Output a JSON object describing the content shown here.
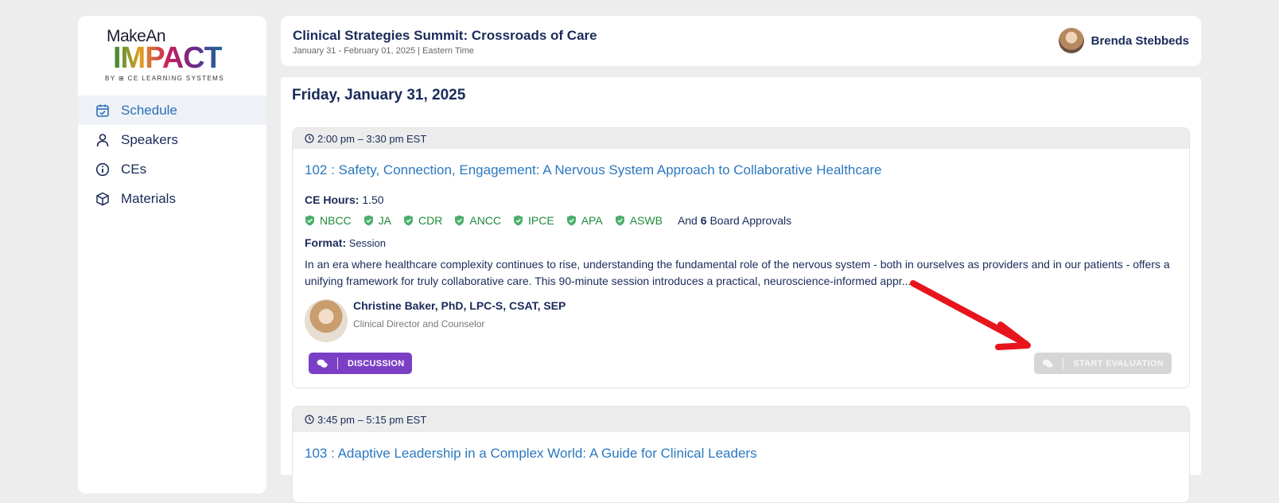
{
  "sidebar": {
    "logo": {
      "line1": "MakeAn",
      "line2": "IMPACT",
      "line3": "BY ⊞ CE LEARNING SYSTEMS"
    },
    "items": [
      {
        "label": "Schedule",
        "icon": "calendar-check-icon",
        "active": true
      },
      {
        "label": "Speakers",
        "icon": "user-icon",
        "active": false
      },
      {
        "label": "CEs",
        "icon": "info-circle-icon",
        "active": false
      },
      {
        "label": "Materials",
        "icon": "box-icon",
        "active": false
      }
    ]
  },
  "header": {
    "title": "Clinical Strategies Summit: Crossroads of Care",
    "dates": "January 31 - February 01, 2025 | Eastern Time",
    "user_name": "Brenda Stebbeds"
  },
  "main": {
    "day_heading": "Friday, January 31, 2025",
    "sessions": [
      {
        "time": "2:00 pm – 3:30 pm EST",
        "title": "102 : Safety, Connection, Engagement: A Nervous System Approach to Collaborative Healthcare",
        "ce_hours_label": "CE Hours:",
        "ce_hours_value": "1.50",
        "approvals": [
          "NBCC",
          "JA",
          "CDR",
          "ANCC",
          "IPCE",
          "APA",
          "ASWB"
        ],
        "more_prefix": "And",
        "more_count": "6",
        "more_suffix": "Board Approvals",
        "format_label": "Format:",
        "format_value": "Session",
        "description": "In an era where healthcare complexity continues to rise, understanding the fundamental role of the nervous system - both in ourselves as providers and in our patients - offers a unifying framework for truly collaborative care. This 90-minute session introduces a practical, neuroscience-informed appr...",
        "speaker_name": "Christine Baker, PhD, LPC-S, CSAT, SEP",
        "speaker_role": "Clinical Director and Counselor",
        "discussion_label": "DISCUSSION",
        "evaluation_label": "START EVALUATION"
      },
      {
        "time": "3:45 pm – 5:15 pm EST",
        "title": "103 : Adaptive Leadership in a Complex World: A Guide for Clinical Leaders"
      }
    ]
  },
  "colors": {
    "accent_link": "#2b78c0",
    "approval_green": "#1f8a3a",
    "discussion_purple": "#7b3fc6",
    "disabled_gray": "#d6d6d6",
    "annotation_red": "#e8141c"
  }
}
